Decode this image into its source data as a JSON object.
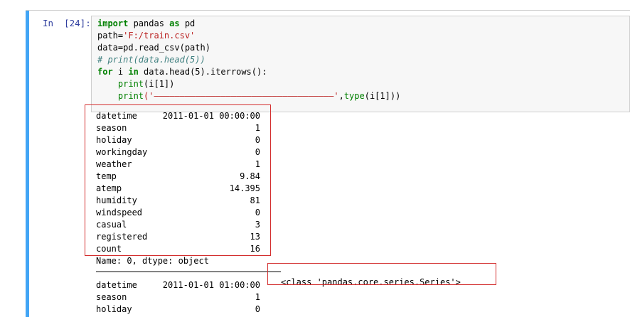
{
  "cell": {
    "prompt": "In  [24]:",
    "code": {
      "line1": {
        "kw1": "import",
        "t1": " pandas ",
        "kw2": "as",
        "t2": " pd"
      },
      "line2": {
        "t1": "path=",
        "str": "'F:/train.csv'"
      },
      "line3": {
        "t1": "data=pd.read_csv(path)"
      },
      "line4": {
        "cmt": "# print(data.head(5))"
      },
      "line5": {
        "kw1": "for",
        "t1": " i ",
        "kw2": "in",
        "t2": " data.head(5).iterrows():"
      },
      "line6": {
        "indent": "    ",
        "bi": "print",
        "t1": "(i[1])"
      },
      "line7": {
        "indent": "    ",
        "bi": "print",
        "str": "('———————————————————————————————————'",
        "t1": ",",
        "bi2": "type",
        "t2": "(i[1]))"
      }
    },
    "output": {
      "series1": [
        {
          "key": "datetime",
          "value": "2011-01-01 00:00:00"
        },
        {
          "key": "season",
          "value": "1"
        },
        {
          "key": "holiday",
          "value": "0"
        },
        {
          "key": "workingday",
          "value": "0"
        },
        {
          "key": "weather",
          "value": "1"
        },
        {
          "key": "temp",
          "value": "9.84"
        },
        {
          "key": "atemp",
          "value": "14.395"
        },
        {
          "key": "humidity",
          "value": "81"
        },
        {
          "key": "windspeed",
          "value": "0"
        },
        {
          "key": "casual",
          "value": "3"
        },
        {
          "key": "registered",
          "value": "13"
        },
        {
          "key": "count",
          "value": "16"
        }
      ],
      "name_dtype": "Name: 0, dtype: object",
      "class_text": "<class 'pandas.core.series.Series'>",
      "series2": [
        {
          "key": "datetime",
          "value": "2011-01-01 01:00:00"
        },
        {
          "key": "season",
          "value": "1"
        },
        {
          "key": "holiday",
          "value": "0"
        }
      ]
    }
  },
  "colors": {
    "cell_bar": "#42a5f5",
    "annotation_box": "#d32f2f",
    "prompt": "#303f9f",
    "keyword": "#008000",
    "string": "#ba2121",
    "comment": "#408080"
  }
}
